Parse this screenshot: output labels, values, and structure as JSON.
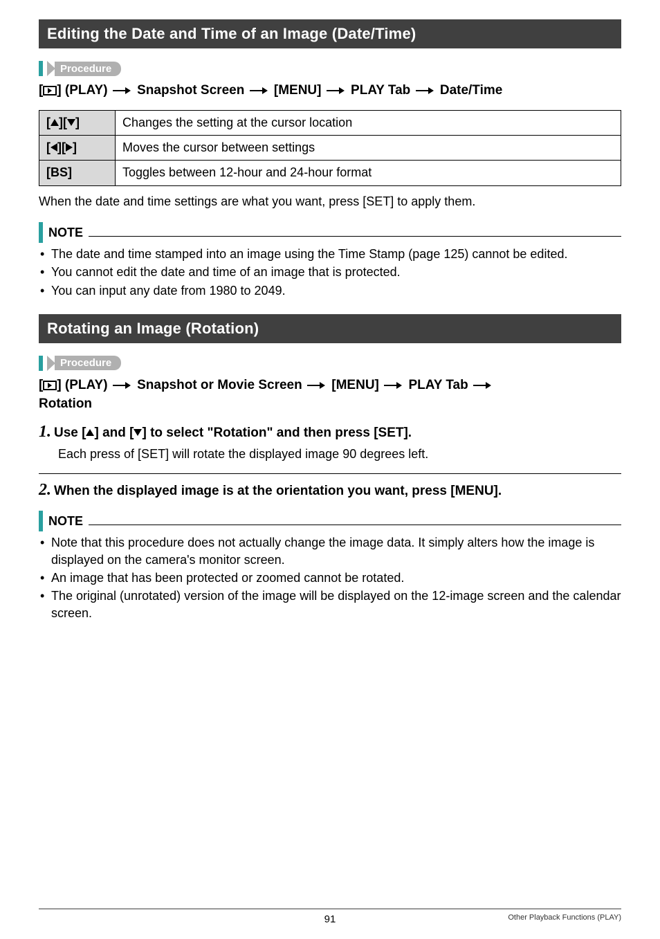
{
  "section1": {
    "heading": "Editing the Date and Time of an Image (Date/Time)",
    "procedure_label": "Procedure",
    "breadcrumb_parts": {
      "p1": "] (PLAY)",
      "p2": "Snapshot Screen",
      "p3": "[MENU]",
      "p4": "PLAY Tab",
      "p5": "Date/Time"
    },
    "table": {
      "r1": {
        "key_open": "[",
        "key_close": "]",
        "desc": "Changes the setting at the cursor location"
      },
      "r2": {
        "key_open": "[",
        "key_close": "]",
        "desc": "Moves the cursor between settings"
      },
      "r3": {
        "key": "[BS]",
        "desc": "Toggles between 12-hour and 24-hour format"
      }
    },
    "after_table": "When the date and time settings are what you want, press [SET] to apply them.",
    "note_label": "NOTE",
    "notes": [
      "The date and time stamped into an image using the Time Stamp (page 125) cannot be edited.",
      "You cannot edit the date and time of an image that is protected.",
      "You can input any date from 1980 to 2049."
    ]
  },
  "section2": {
    "heading": "Rotating an Image (Rotation)",
    "procedure_label": "Procedure",
    "breadcrumb_parts": {
      "p1": "] (PLAY)",
      "p2": "Snapshot or Movie Screen",
      "p3": "[MENU]",
      "p4": "PLAY Tab",
      "p5": "Rotation"
    },
    "step1": {
      "num": "1.",
      "title_a": "Use [",
      "title_b": "] and [",
      "title_c": "] to select \"Rotation\" and then press [SET].",
      "desc": "Each press of [SET] will rotate the displayed image 90 degrees left."
    },
    "step2": {
      "num": "2.",
      "title": "When the displayed image is at the orientation you want, press [MENU]."
    },
    "note_label": "NOTE",
    "notes": [
      "Note that this procedure does not actually change the image data. It simply alters how the image is displayed on the camera's monitor screen.",
      "An image that has been protected or zoomed cannot be rotated.",
      "The original (unrotated) version of the image will be displayed on the 12-image screen and the calendar screen."
    ]
  },
  "footer": {
    "page": "91",
    "text": "Other Playback Functions (PLAY)"
  }
}
